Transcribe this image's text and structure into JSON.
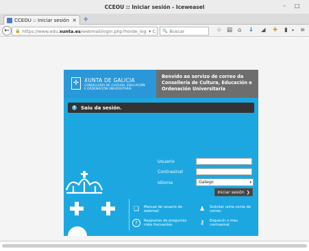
{
  "window": {
    "title": "CCEOU :: Iniciar sesión - Iceweasel",
    "minimize": "–",
    "maximize": "□"
  },
  "tab": {
    "label": "CCEOU :: Iniciar sesión",
    "close": "×",
    "new_tab": "+"
  },
  "navbar": {
    "back": "←",
    "url_prefix": "https://www.edu.",
    "url_domain": "xunta.es",
    "url_path": "/webmail/login.php?horde_logo",
    "url_controls": "▾ C",
    "search_placeholder": "Buscar",
    "icons": {
      "bookmark_star": "☆",
      "library": "▤",
      "home": "⌂",
      "download": "↓",
      "send": "◢",
      "addon": "✚",
      "reader": "▮",
      "menu_chevron": "▾",
      "menu": "≡"
    }
  },
  "page": {
    "brand_name": "XUNTA DE GALICIA",
    "brand_department": "CONSELLERÍA DE CULTURA, EDUCACIÓN\nE ORDENACIÓN UNIVERSITARIA",
    "welcome": "Benvido ao servizo de correo da Consellería de Cultura, Educación e Ordenación Universitaria",
    "notice": "Saíu da sesión.",
    "notice_icon": "i",
    "form": {
      "user_label": "Usuario",
      "user_value": "",
      "password_label": "Contrasinal",
      "password_value": "",
      "language_label": "Idioma",
      "language_value": "Galego",
      "language_chevron": "▾",
      "submit_label": "Iniciar sesión",
      "submit_arrow": "❯"
    },
    "links": [
      {
        "icon": "book-icon",
        "glyph": "❏",
        "text": "Manual de usuario do\nwebmail"
      },
      {
        "icon": "help-icon",
        "glyph": "?",
        "text": "Respostas de preguntas\nmáis frecuentes"
      },
      {
        "icon": "user-add-icon",
        "glyph": "♟",
        "text": "Solicitar unha conta de\ncorreo"
      },
      {
        "icon": "key-icon",
        "glyph": "⚷",
        "text": "Esquecín o meu\ncontrasinal"
      }
    ]
  },
  "colors": {
    "brand_blue": "#1da7e1",
    "dark_notice": "#333333",
    "welcome_gray": "#6e6e6e"
  }
}
